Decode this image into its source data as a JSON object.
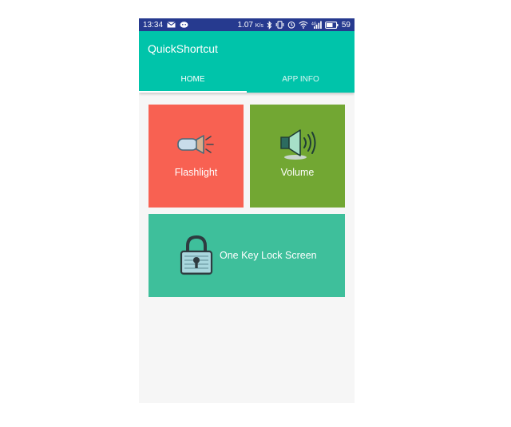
{
  "status_bar": {
    "time": "13:34",
    "speed": "1.07",
    "speed_unit": "K/s",
    "battery": "59",
    "left_icons": [
      "mail-icon",
      "chat-icon"
    ],
    "right_icons": [
      "bluetooth-icon",
      "vibrate-icon",
      "alarm-icon",
      "wifi-icon",
      "signal-icon",
      "battery-icon"
    ]
  },
  "app": {
    "title": "QuickShortcut",
    "primary_color": "#00c4aa",
    "status_bar_color": "#263a8f"
  },
  "tabs": [
    {
      "label": "HOME",
      "selected": true
    },
    {
      "label": "APP INFO",
      "selected": false
    }
  ],
  "tiles": [
    {
      "label": "Flashlight",
      "icon": "flashlight-icon",
      "color": "#f86152"
    },
    {
      "label": "Volume",
      "icon": "speaker-icon",
      "color": "#72a733"
    },
    {
      "label": "One Key Lock Screen",
      "icon": "lock-icon",
      "color": "#3ebf9b"
    }
  ]
}
